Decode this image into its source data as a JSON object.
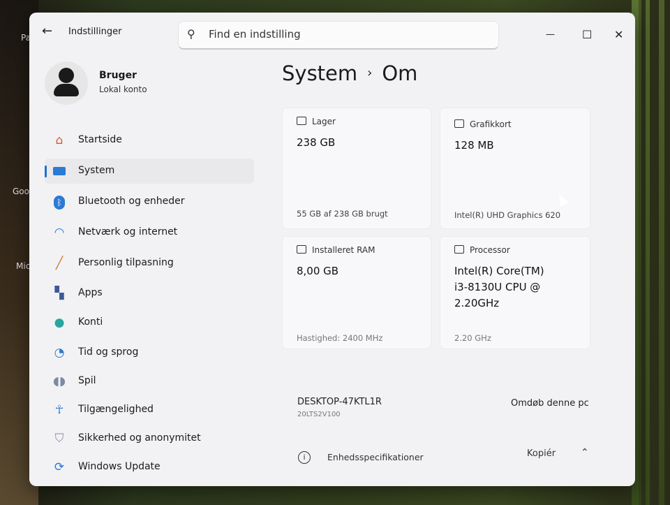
{
  "desktop": {
    "icons": [
      {
        "label": "Pa"
      },
      {
        "label": "Goog"
      },
      {
        "label": "Micr"
      }
    ]
  },
  "window": {
    "title": "Indstillinger",
    "back_icon": "back-arrow-icon",
    "search": {
      "placeholder": "Find en indstilling",
      "icon": "search-icon"
    },
    "controls": {
      "minimize": "—",
      "maximize": "☐",
      "close": "✕"
    }
  },
  "profile": {
    "name": "Bruger",
    "account_type": "Lokal konto"
  },
  "nav": {
    "items": [
      {
        "label": "Startside",
        "icon": "home-icon"
      },
      {
        "label": "System",
        "icon": "system-icon",
        "active": true
      },
      {
        "label": "Bluetooth og enheder",
        "icon": "bluetooth-icon"
      },
      {
        "label": "Netværk og internet",
        "icon": "wifi-icon"
      },
      {
        "label": "Personlig tilpasning",
        "icon": "brush-icon"
      },
      {
        "label": "Apps",
        "icon": "apps-icon"
      },
      {
        "label": "Konti",
        "icon": "account-icon"
      },
      {
        "label": "Tid og sprog",
        "icon": "globe-clock-icon"
      },
      {
        "label": "Spil",
        "icon": "gamepad-icon"
      },
      {
        "label": "Tilgængelighed",
        "icon": "accessibility-icon"
      },
      {
        "label": "Sikkerhed og anonymitet",
        "icon": "shield-icon"
      },
      {
        "label": "Windows Update",
        "icon": "update-icon"
      }
    ]
  },
  "breadcrumb": {
    "parent": "System",
    "separator": "›",
    "current": "Om"
  },
  "cards": {
    "storage": {
      "label": "Lager",
      "value": "238 GB",
      "detail": "55 GB af 238 GB brugt"
    },
    "graphics": {
      "label": "Grafikkort",
      "value": "128 MB",
      "detail": "Intel(R) UHD Graphics 620"
    },
    "ram": {
      "label": "Installeret RAM",
      "value": "8,00 GB",
      "detail": "Hastighed: 2400 MHz"
    },
    "processor": {
      "label": "Processor",
      "value_lines": [
        "Intel(R) Core(TM)",
        "i3-8130U CPU @",
        "2.20GHz"
      ],
      "detail": "2.20 GHz"
    }
  },
  "device": {
    "name": "DESKTOP-47KTL1R",
    "model": "20LTS2V100",
    "rename_label": "Omdøb denne pc"
  },
  "specs": {
    "title": "Enhedsspecifikationer",
    "copy_label": "Kopiér",
    "collapse_icon": "chevron-up-icon"
  },
  "colors": {
    "accent": "#1f6fd0",
    "window_bg": "#f2f2f4"
  }
}
